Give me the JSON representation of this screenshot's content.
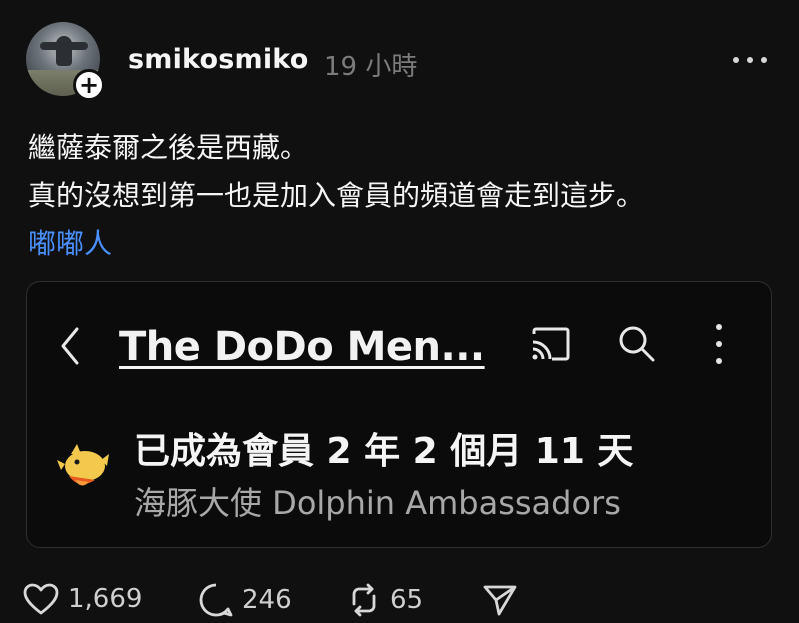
{
  "post": {
    "username": "smikosmiko",
    "timestamp": "19 小時",
    "text_line_1": "繼薩泰爾之後是西藏。",
    "text_line_2": "真的沒想到第一也是加入會員的頻道會走到這步。",
    "mention": "嘟嘟人",
    "avatar_icon": "profile-avatar",
    "follow_icon": "plus-icon"
  },
  "embed": {
    "channel_title": "The DoDo Men...",
    "membership_duration": "已成為會員 2 年 2 個月 11 天",
    "badge_name": "海豚大使 Dolphin Ambassadors",
    "icons": [
      "back-icon",
      "cast-icon",
      "search-icon",
      "more-vertical-icon",
      "dolphin-badge-icon"
    ]
  },
  "actions": {
    "likes": "1,669",
    "comments": "246",
    "reposts": "65",
    "icons": [
      "heart-icon",
      "comment-icon",
      "repost-icon",
      "share-icon"
    ]
  },
  "colors": {
    "background": "#101010",
    "text": "#f5f5f5",
    "muted": "#7b7b7b",
    "link": "#4a90ff",
    "dolphin": "#f2c94c"
  }
}
